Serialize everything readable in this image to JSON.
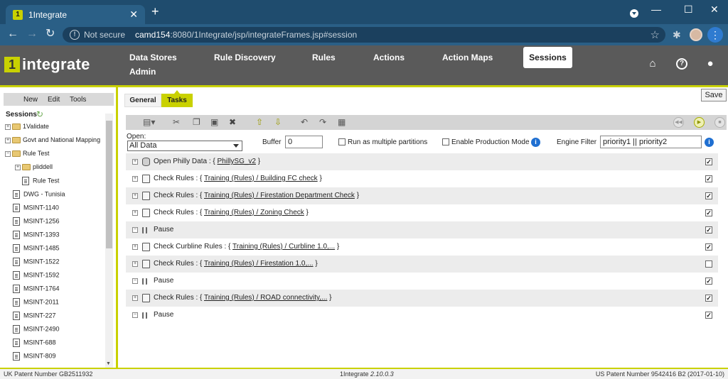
{
  "browser": {
    "tab_title": "1Integrate",
    "tab_favicon": "1",
    "new_tab": "+",
    "security": "Not secure",
    "url_host": "camd154",
    "url_rest": ":8080/1Integrate/jsp/integrateFrames.jsp#session"
  },
  "app": {
    "logo_mark": "1",
    "logo_text": "integrate",
    "nav": {
      "data_stores": "Data Stores",
      "admin": "Admin",
      "rule_discovery": "Rule Discovery",
      "rules": "Rules",
      "actions": "Actions",
      "action_maps": "Action Maps",
      "sessions": "Sessions"
    },
    "accent_color": "#c9d100"
  },
  "sidebar": {
    "menu": {
      "new": "New",
      "edit": "Edit",
      "tools": "Tools"
    },
    "header": "Sessions",
    "tree": [
      {
        "label": "1Validate",
        "type": "folder"
      },
      {
        "label": "Govt and National Mapping",
        "type": "folder"
      },
      {
        "label": "Rule Test",
        "type": "folder-open"
      },
      {
        "label": "pliddell",
        "type": "folder"
      },
      {
        "label": "Rule Test",
        "type": "doc"
      },
      {
        "label": "DWG - Tunisia",
        "type": "doc"
      },
      {
        "label": "MSINT-1140",
        "type": "doc"
      },
      {
        "label": "MSINT-1256",
        "type": "doc"
      },
      {
        "label": "MSINT-1393",
        "type": "doc"
      },
      {
        "label": "MSINT-1485",
        "type": "doc"
      },
      {
        "label": "MSINT-1522",
        "type": "doc"
      },
      {
        "label": "MSINT-1592",
        "type": "doc"
      },
      {
        "label": "MSINT-1764",
        "type": "doc"
      },
      {
        "label": "MSINT-2011",
        "type": "doc"
      },
      {
        "label": "MSINT-227",
        "type": "doc"
      },
      {
        "label": "MSINT-2490",
        "type": "doc"
      },
      {
        "label": "MSINT-688",
        "type": "doc"
      },
      {
        "label": "MSINT-809",
        "type": "doc"
      }
    ]
  },
  "main": {
    "tabs": {
      "general": "General",
      "tasks": "Tasks"
    },
    "save": "Save",
    "open_label": "Open:",
    "open_value": "All Data",
    "buffer_label": "Buffer",
    "buffer_value": "0",
    "multi_label": "Run as multiple partitions",
    "prod_label": "Enable Production Mode",
    "engine_filter_label": "Engine Filter",
    "engine_filter_value": "priority1 || priority2",
    "tasks": [
      {
        "icon": "database-icon",
        "name": "Open Philly Data",
        "prefix": " : { ",
        "link": "PhillySG_v2",
        "suffix": " }",
        "checked": true
      },
      {
        "icon": "check-rules-icon",
        "name": "Check Rules",
        "prefix": " : { ",
        "link": "Training (Rules) / Building FC check",
        "suffix": " }",
        "checked": true
      },
      {
        "icon": "check-rules-icon",
        "name": "Check Rules",
        "prefix": " : { ",
        "link": "Training (Rules) / Firestation Department Check",
        "suffix": " }",
        "checked": true
      },
      {
        "icon": "check-rules-icon",
        "name": "Check Rules",
        "prefix": " : { ",
        "link": "Training (Rules) / Zoning Check",
        "suffix": " }",
        "checked": true
      },
      {
        "icon": "pause-icon",
        "name": "Pause",
        "prefix": "",
        "link": "",
        "suffix": "",
        "checked": true
      },
      {
        "icon": "check-rules-icon",
        "name": "Check Curbline Rules",
        "prefix": " : { ",
        "link": "Training (Rules) / Curbline 1.0,...",
        "suffix": " }",
        "checked": true
      },
      {
        "icon": "check-rules-icon",
        "name": "Check Rules",
        "prefix": " : { ",
        "link": "Training (Rules) / Firestation 1.0,...",
        "suffix": " }",
        "checked": false
      },
      {
        "icon": "pause-icon",
        "name": "Pause",
        "prefix": "",
        "link": "",
        "suffix": "",
        "checked": true
      },
      {
        "icon": "check-rules-icon",
        "name": "Check Rules",
        "prefix": " : { ",
        "link": "Training (Rules) / ROAD connectivity,...",
        "suffix": " }",
        "checked": true
      },
      {
        "icon": "pause-icon",
        "name": "Pause",
        "prefix": "",
        "link": "",
        "suffix": "",
        "checked": true
      }
    ]
  },
  "footer": {
    "left": "UK Patent Number GB2511932",
    "center_name": "1Integrate",
    "center_version": "2.10.0.3",
    "right": "US Patent Number 9542416 B2 (2017-01-10)"
  }
}
